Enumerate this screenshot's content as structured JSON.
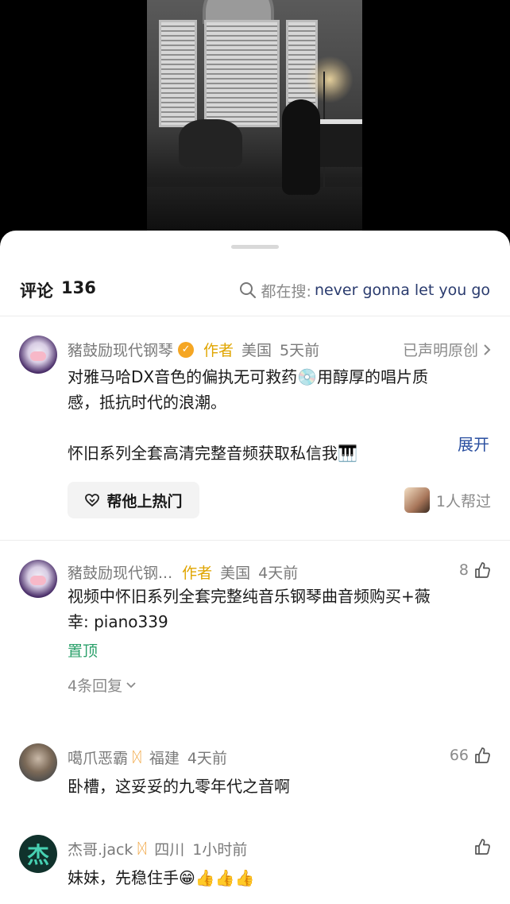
{
  "header": {
    "count_label": "评论",
    "count": "136",
    "search_prefix": "都在搜:",
    "search_query": "never gonna let you go"
  },
  "comments": [
    {
      "username": "豬鼓励现代钢琴",
      "author_tag": "作者",
      "location": "美国",
      "time": "5天前",
      "declared": "已声明原创",
      "text_line1": "对雅马哈DX音色的偏执无可救药",
      "text_line1b": "用醇厚的唱片质",
      "text_line2": "感，抵抗时代的浪潮。",
      "text_line3": "怀旧系列全套高清完整音频获取私信我",
      "expand": "展开",
      "hot_button": "帮他上热门",
      "helped": "1人帮过"
    },
    {
      "username": "豬鼓励现代钢...",
      "author_tag": "作者",
      "location": "美国",
      "time": "4天前",
      "likes": "8",
      "text_line1": "视频中怀旧系列全套完整纯音乐钢琴曲音频购买+薇",
      "text_line2": "幸: piano339",
      "pinned": "置顶",
      "replies": "4条回复"
    },
    {
      "username": "噶爪恶霸",
      "location": "福建",
      "time": "4天前",
      "likes": "66",
      "text": "卧槽，这妥妥的九零年代之音啊"
    },
    {
      "username": "杰哥.jack",
      "avatar_text": "杰",
      "location": "四川",
      "time": "1小时前",
      "text": "妹妹，先稳住手"
    }
  ],
  "colors": {
    "author_tag": "#e0a500",
    "link": "#2a4fa0",
    "pinned": "#2aa06a",
    "muted": "#8a8a8a"
  }
}
